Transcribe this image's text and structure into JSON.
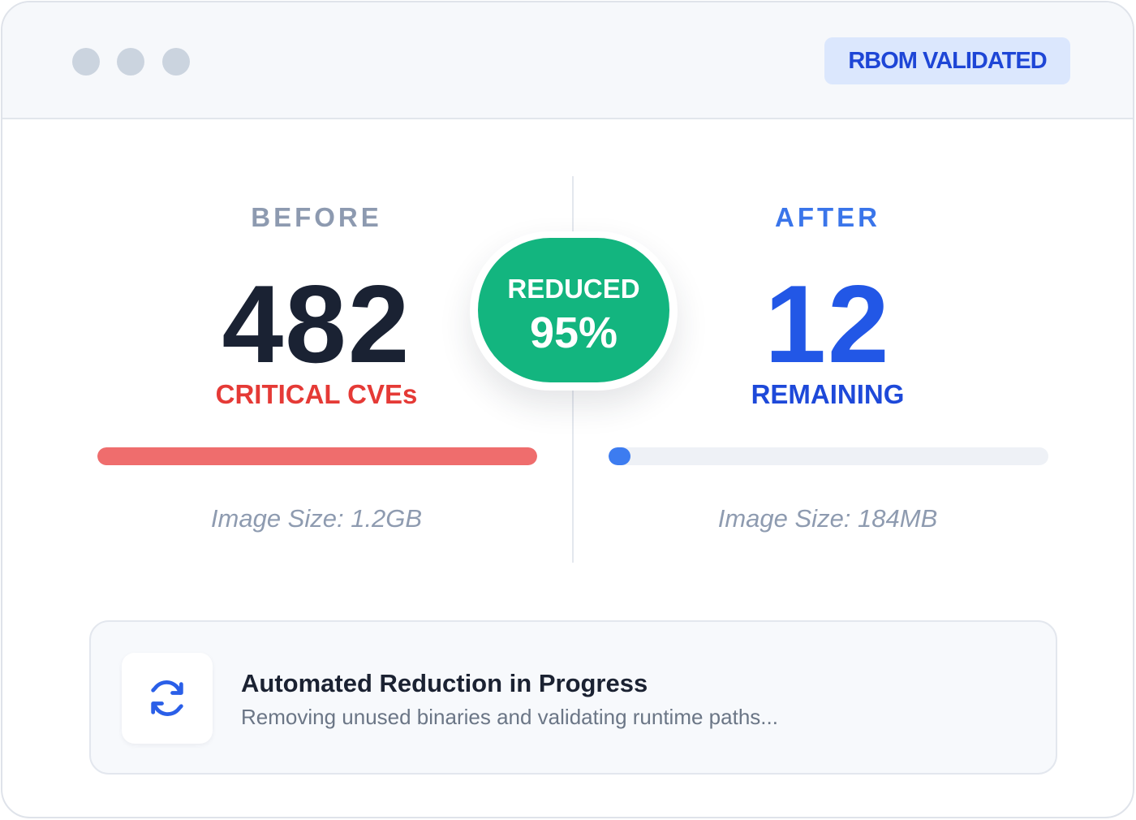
{
  "header": {
    "badge_label": "RBOM VALIDATED"
  },
  "before": {
    "label": "BEFORE",
    "count": "482",
    "sub_label": "CRITICAL CVEs",
    "bar_fill_percent": 100,
    "image_size": "Image Size: 1.2GB"
  },
  "after": {
    "label": "AFTER",
    "count": "12",
    "sub_label": "REMAINING",
    "bar_fill_percent": 5,
    "image_size": "Image Size: 184MB"
  },
  "reduction": {
    "title": "REDUCED",
    "value": "95%"
  },
  "progress": {
    "icon": "refresh-icon",
    "title": "Automated Reduction in Progress",
    "description": "Removing unused binaries and validating runtime paths..."
  },
  "colors": {
    "accent_blue": "#2257e6",
    "critical_red": "#e53a36",
    "success_green": "#13b57f",
    "before_bar": "#ef6d6d",
    "after_bar": "#3d7cf0"
  }
}
